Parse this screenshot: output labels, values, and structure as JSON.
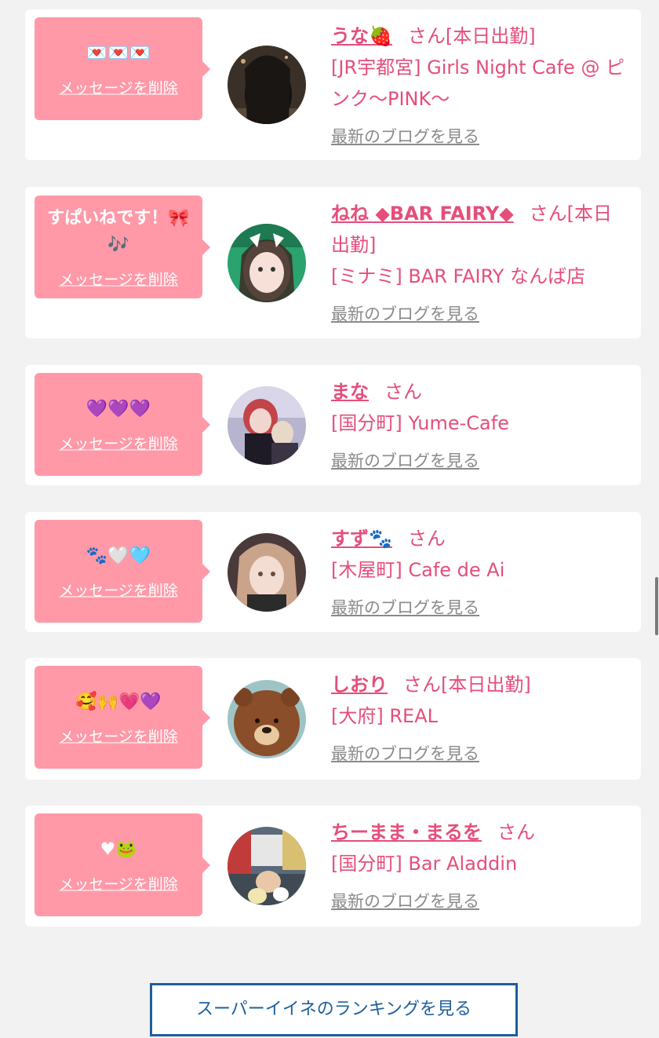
{
  "messages": [
    {
      "message": "💌💌💌",
      "delete_label": "メッセージを削除",
      "name": "うな🍓",
      "suffix": "さん[本日出勤]",
      "shop": "[JR宇都宮] Girls Night Cafe @ ピンク〜PINK〜",
      "blog_label": "最新のブログを見る",
      "avatar": "avatar-dark-hair"
    },
    {
      "message": "すぱいねです！🎀🎶",
      "delete_label": "メッセージを削除",
      "name": "ねね ◆BAR FAIRY◆",
      "suffix": "さん[本日出勤]",
      "shop": "[ミナミ] BAR FAIRY なんば店",
      "blog_label": "最新のブログを見る",
      "avatar": "avatar-cat-ears"
    },
    {
      "message": "💜💜💜",
      "delete_label": "メッセージを削除",
      "name": "まな",
      "suffix": "さん",
      "shop": "[国分町] Yume-Cafe",
      "blog_label": "最新のブログを見る",
      "avatar": "avatar-red-hair"
    },
    {
      "message": "🐾🤍🩵",
      "delete_label": "メッセージを削除",
      "name": "すず🐾",
      "suffix": "さん",
      "shop": "[木屋町] Cafe de Ai",
      "blog_label": "最新のブログを見る",
      "avatar": "avatar-blonde"
    },
    {
      "message": "🥰🙌💗💜",
      "delete_label": "メッセージを削除",
      "name": "しおり",
      "suffix": "さん[本日出勤]",
      "shop": "[大府] REAL",
      "blog_label": "最新のブログを見る",
      "avatar": "avatar-bear"
    },
    {
      "message": "♥🐸",
      "delete_label": "メッセージを削除",
      "name": "ちーまま・まるを",
      "suffix": "さん",
      "shop": "[国分町] Bar Aladdin",
      "blog_label": "最新のブログを見る",
      "avatar": "avatar-street"
    }
  ],
  "ranking_button": "スーパーイイネのランキングを見る",
  "colors": {
    "bubble": "#ff99a8",
    "accent_text": "#e54e7a",
    "link_gray": "#8a8a8a",
    "button_border": "#1d5f9c",
    "page_bg": "#f2f2f2"
  }
}
